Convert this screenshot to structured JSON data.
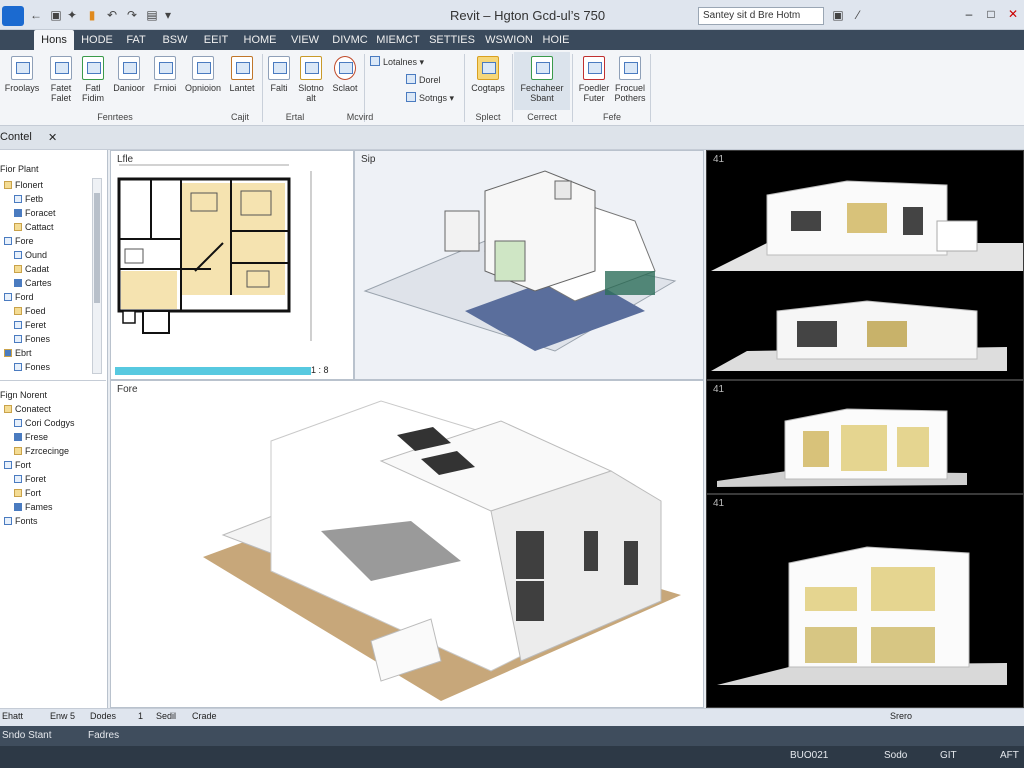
{
  "title_bar": {
    "app_title": "Revit – Hgton Gcd-ul’s 750",
    "search_text": "Santey sit d Bre Hotm",
    "minimize": "–",
    "maximize": "□",
    "close": "✕"
  },
  "tabs": [
    "Hons",
    "HODE",
    "FAT",
    "BSW",
    "EEIT",
    "HOME",
    "VIEW",
    "DIVMC",
    "MIEMCT",
    "SETTIES",
    "WSWION",
    "HOIE"
  ],
  "ribbon": {
    "buttons": [
      {
        "label": "Froolays",
        "icon": "filter-icon"
      },
      {
        "label": "Fatet\nFalet",
        "icon": "document-icon"
      },
      {
        "label": "Fatl\nFidim",
        "icon": "document-icon"
      },
      {
        "label": "Danioor",
        "icon": "document-icon"
      },
      {
        "label": "Frnioi",
        "icon": "image-icon"
      },
      {
        "label": "Opnioion",
        "icon": "image-icon"
      },
      {
        "label": "Lantet",
        "icon": "tag-icon"
      },
      {
        "label": "Falti",
        "icon": "table-icon"
      },
      {
        "label": "Slotno\nalt",
        "icon": "folder-icon"
      },
      {
        "label": "Sclaot",
        "icon": "select-icon"
      },
      {
        "label": "Cogtaps",
        "icon": "folder-icon"
      },
      {
        "label": "Fechaheer\nSbant",
        "icon": "component-icon"
      },
      {
        "label": "Foedler\nFuter",
        "icon": "number-icon"
      },
      {
        "label": "Frocuel\nPothers",
        "icon": "document-icon"
      }
    ],
    "small_rows": [
      "Lotalnes",
      "Dorel",
      "Sotngs"
    ],
    "panels": [
      "Fenrtees",
      "Cajit",
      "Ertal",
      "Mcvird",
      "Splect",
      "Cerrect",
      "Fefe"
    ]
  },
  "properties_bar": {
    "label": "Contel",
    "close": "✕"
  },
  "project_browser": {
    "group1_title": "Fior Plant",
    "group1_items": [
      "Flonert",
      "Fetb",
      "Foracet",
      "Cattact",
      "Fore",
      "Ound",
      "Cadat",
      "Cartes",
      "Ford",
      "Foed",
      "Feret",
      "Fones",
      "Ebrt",
      "Fones"
    ],
    "group2_title": "Fign Norent",
    "group2_items": [
      "Conatect",
      "Cori Codgys",
      "Frese",
      "Fzrcecinge",
      "Fort",
      "Foret",
      "Fort",
      "Fames",
      "Fonts"
    ]
  },
  "views": {
    "plan_label": "Lfle",
    "iso_label": "Sip",
    "model_label": "Fore",
    "render_labels": [
      "41",
      "",
      "41",
      "41"
    ],
    "plan_scale": "1 : 8"
  },
  "view_control_bar": {
    "items": [
      "Ehatt",
      "Enw 5",
      "Dodes",
      "1",
      "Sedil",
      "Crade"
    ],
    "right": "Srero"
  },
  "status_bar": {
    "left": "Sndo Stant",
    "mid": "Fadres",
    "right_items": [
      "BUO021",
      "Sodo",
      "GIT",
      "AFT"
    ]
  },
  "colors": {
    "tab_bar": "#3a4a5c",
    "ribbon": "#f3f5f8",
    "accent": "#4a7bc0",
    "plan_room_fill": "#f5e3b0"
  }
}
